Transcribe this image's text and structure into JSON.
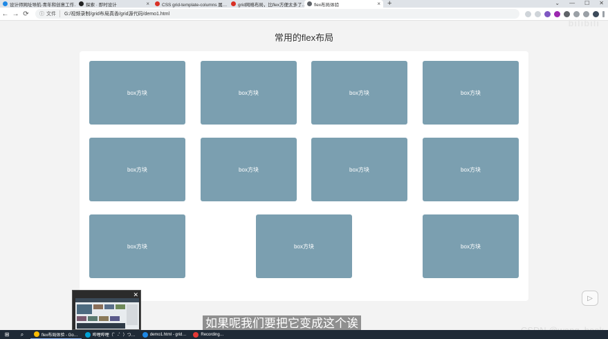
{
  "browser": {
    "tabs": [
      {
        "title": "设计师网址导航-青年和创意工作…",
        "icon_color": "#1e88e5",
        "active": false
      },
      {
        "title": "探索 · 即时设计",
        "icon_color": "#222222",
        "active": false
      },
      {
        "title": "CSS grid-template-columns 属…",
        "icon_color": "#d93025",
        "active": false
      },
      {
        "title": "grid网格布局，比flex方便太多了…",
        "icon_color": "#d93025",
        "active": false
      },
      {
        "title": "flex布局体验",
        "icon_color": "#5f6368",
        "active": true
      }
    ],
    "new_tab": "+",
    "window_controls": [
      "⌄",
      "—",
      "☐",
      "✕"
    ],
    "address": {
      "security_label": "文件",
      "url": "G:/视频录制/grid布局真香/grid源代码/demo1.html"
    }
  },
  "page": {
    "heading": "常用的flex布局",
    "box_label": "box方块",
    "boxes": [
      {
        "label": "box方块"
      },
      {
        "label": "box方块"
      },
      {
        "label": "box方块"
      },
      {
        "label": "box方块"
      },
      {
        "label": "box方块"
      },
      {
        "label": "box方块"
      },
      {
        "label": "box方块"
      },
      {
        "label": "box方块"
      },
      {
        "label": "box方块"
      },
      {
        "label": "box方块"
      },
      {
        "label": "box方块"
      }
    ],
    "box_color": "#7b9fb0"
  },
  "overlay": {
    "watermark": "bilibili",
    "subtitle": "如果呢我们要把它变成这个诶",
    "csdn_watermark": "CSDN @wang_book",
    "play_icon": "play-icon"
  },
  "taskbar": {
    "items": [
      {
        "label": "flex布局体验 - Go…",
        "icon_color": "#fbbc04"
      },
      {
        "label": "哔哩哔哩（゜-゜）つ…",
        "icon_color": "#00a1d6"
      },
      {
        "label": "demo1.html - grid…",
        "icon_color": "#1e88e5"
      },
      {
        "label": "Recording…",
        "icon_color": "#e53935"
      }
    ]
  }
}
